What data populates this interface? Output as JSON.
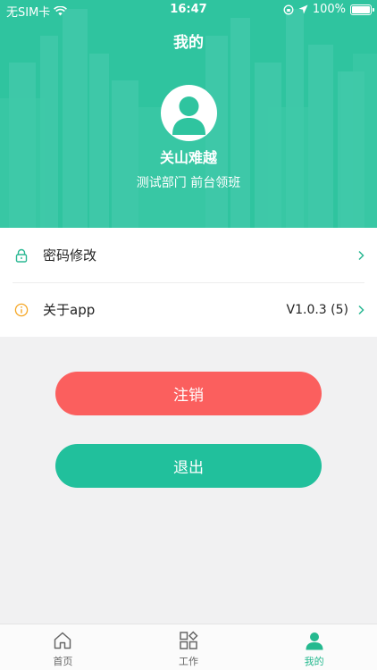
{
  "status_bar": {
    "carrier": "无SIM卡",
    "time": "16:47",
    "battery": "100%",
    "battery_level": 1.0
  },
  "header": {
    "title": "我的",
    "user_name": "关山难越",
    "department": "测试部门 前台领班"
  },
  "menu": {
    "items": [
      {
        "label": "密码修改",
        "value": "",
        "icon": "lock-icon"
      },
      {
        "label": "关于app",
        "value": "V1.0.3 (5)",
        "icon": "info-icon"
      }
    ]
  },
  "buttons": {
    "logout_label": "注销",
    "exit_label": "退出"
  },
  "tabbar": {
    "items": [
      {
        "label": "首页",
        "icon": "home-icon",
        "active": false
      },
      {
        "label": "工作",
        "icon": "grid-icon",
        "active": false
      },
      {
        "label": "我的",
        "icon": "user-icon",
        "active": true
      }
    ]
  },
  "colors": {
    "header_bg": "#2fc49f",
    "logout": "#fb5f5e",
    "exit": "#21c09c",
    "accent": "#25b98f"
  }
}
